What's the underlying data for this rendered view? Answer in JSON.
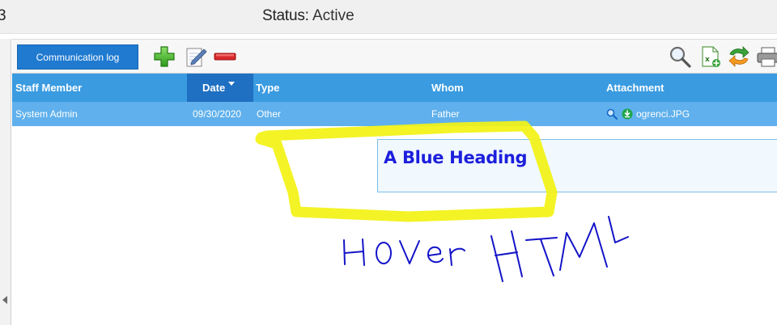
{
  "topbar": {
    "edge_char": "3",
    "status_label": "Status:",
    "status_value": "Active"
  },
  "toolbar": {
    "comm_label": "Communication log",
    "left_icons": [
      "add-icon",
      "edit-icon",
      "delete-icon"
    ],
    "right_icons": [
      "search-icon",
      "excel-export-icon",
      "refresh-icon",
      "print-icon"
    ]
  },
  "table": {
    "headers": {
      "staff": "Staff Member",
      "date": "Date",
      "type": "Type",
      "whom": "Whom",
      "attachment": "Attachment"
    },
    "sorted_column": "date",
    "rows": [
      {
        "staff": "System Admin",
        "date": "09/30/2020",
        "type": "Other",
        "whom": "Father",
        "attachment": "ogrenci.JPG"
      }
    ]
  },
  "tooltip": {
    "heading": "A Blue Heading"
  },
  "annotation": {
    "handwritten_text": "HOVer HTML",
    "highlight_color": "#f2f216",
    "ink_color": "#1414c8"
  }
}
